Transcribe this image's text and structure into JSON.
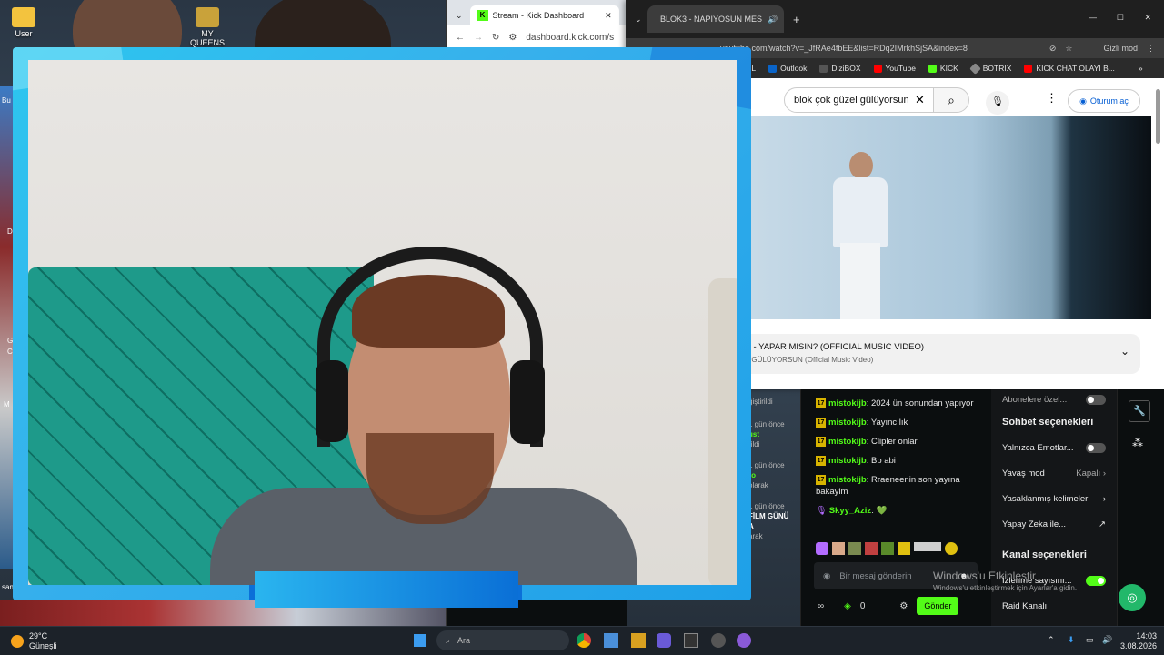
{
  "desktop": {
    "icons": [
      {
        "label": "User"
      },
      {
        "label": "MY QUEENS"
      }
    ],
    "fragments": [
      "Bu",
      "D",
      "G",
      "C",
      "M",
      "san"
    ]
  },
  "kick_window": {
    "tab_title": "Stream - Kick Dashboard",
    "url": "dashboard.kick.com/s",
    "left_fragments": [
      {
        "a": "ğiştirildi"
      },
      {
        "a": "1 gün önce",
        "b": "ust",
        "c": "rildi"
      },
      {
        "a": "1 gün önce",
        "b": "ro",
        "c": "olarak"
      },
      {
        "a": "1 gün önce",
        "b": "FİLM GÜNÜ",
        "c": "A",
        "d": "arak"
      }
    ]
  },
  "youtube_window": {
    "tab_title": "BLOK3 - NAPIYOSUN MES",
    "url": "youtube.com/watch?v=_JfRAe4fbEE&list=RDq2IMrkhSjSA&index=8",
    "incognito_label": "Gizli mod",
    "bookmarks": [
      "İL",
      "Outlook",
      "DiziBOX",
      "YouTube",
      "KICK",
      "BOTRİX",
      "KICK CHAT OLAYI B..."
    ],
    "search_value": "blok çok güzel gülüyorsun",
    "signin_label": "Oturum aç",
    "video_title": "Z - YAPAR MISIN? (OFFICIAL MUSIC VIDEO)",
    "video_subtitle": "L GÜLÜYORSUN (Official Music Video)"
  },
  "chat": {
    "messages": [
      {
        "badge": "17",
        "user": "mistokijb",
        "text": "2024 ün sonundan yapıyor"
      },
      {
        "badge": "17",
        "user": "mistokijb",
        "text": "Yayıncılık"
      },
      {
        "badge": "17",
        "user": "mistokijb",
        "text": "Clipler onlar"
      },
      {
        "badge": "17",
        "user": "mistokijb",
        "text": "Bb abi"
      },
      {
        "badge": "17",
        "user": "mistokijb",
        "text": "Rraeneenin son yayına bakayim"
      },
      {
        "badge": "",
        "user": "Skyy_Aziz",
        "text": "💚"
      }
    ],
    "input_placeholder": "Bir mesaj gönderin",
    "points": "0",
    "send_label": "Gönder"
  },
  "settings": {
    "top_item": "Abonelere özel...",
    "chat_options_title": "Sohbet seçenekleri",
    "emotes_only": "Yalnızca Emotlar...",
    "slow_mode": "Yavaş mod",
    "slow_mode_value": "Kapalı",
    "banned_words": "Yasaklanmış kelimeler",
    "ai": "Yapay Zeka ile...",
    "channel_options_title": "Kanal seçenekleri",
    "viewer_count": "İzlenme sayısını...",
    "raid": "Raid Kanalı"
  },
  "watermark": {
    "line1": "Windows'u Etkinleştir",
    "line2": "Windows'u etkinleştirmek için Ayarlar'a gidin."
  },
  "taskbar": {
    "weather_temp": "29°C",
    "weather_desc": "Güneşli",
    "search_placeholder": "Ara",
    "time": "14:03",
    "date": "3.08.2026"
  },
  "colors": {
    "kick_green": "#53fc18",
    "frame_blue": "#2cc6ef",
    "sub_badge": "#d8b400"
  }
}
